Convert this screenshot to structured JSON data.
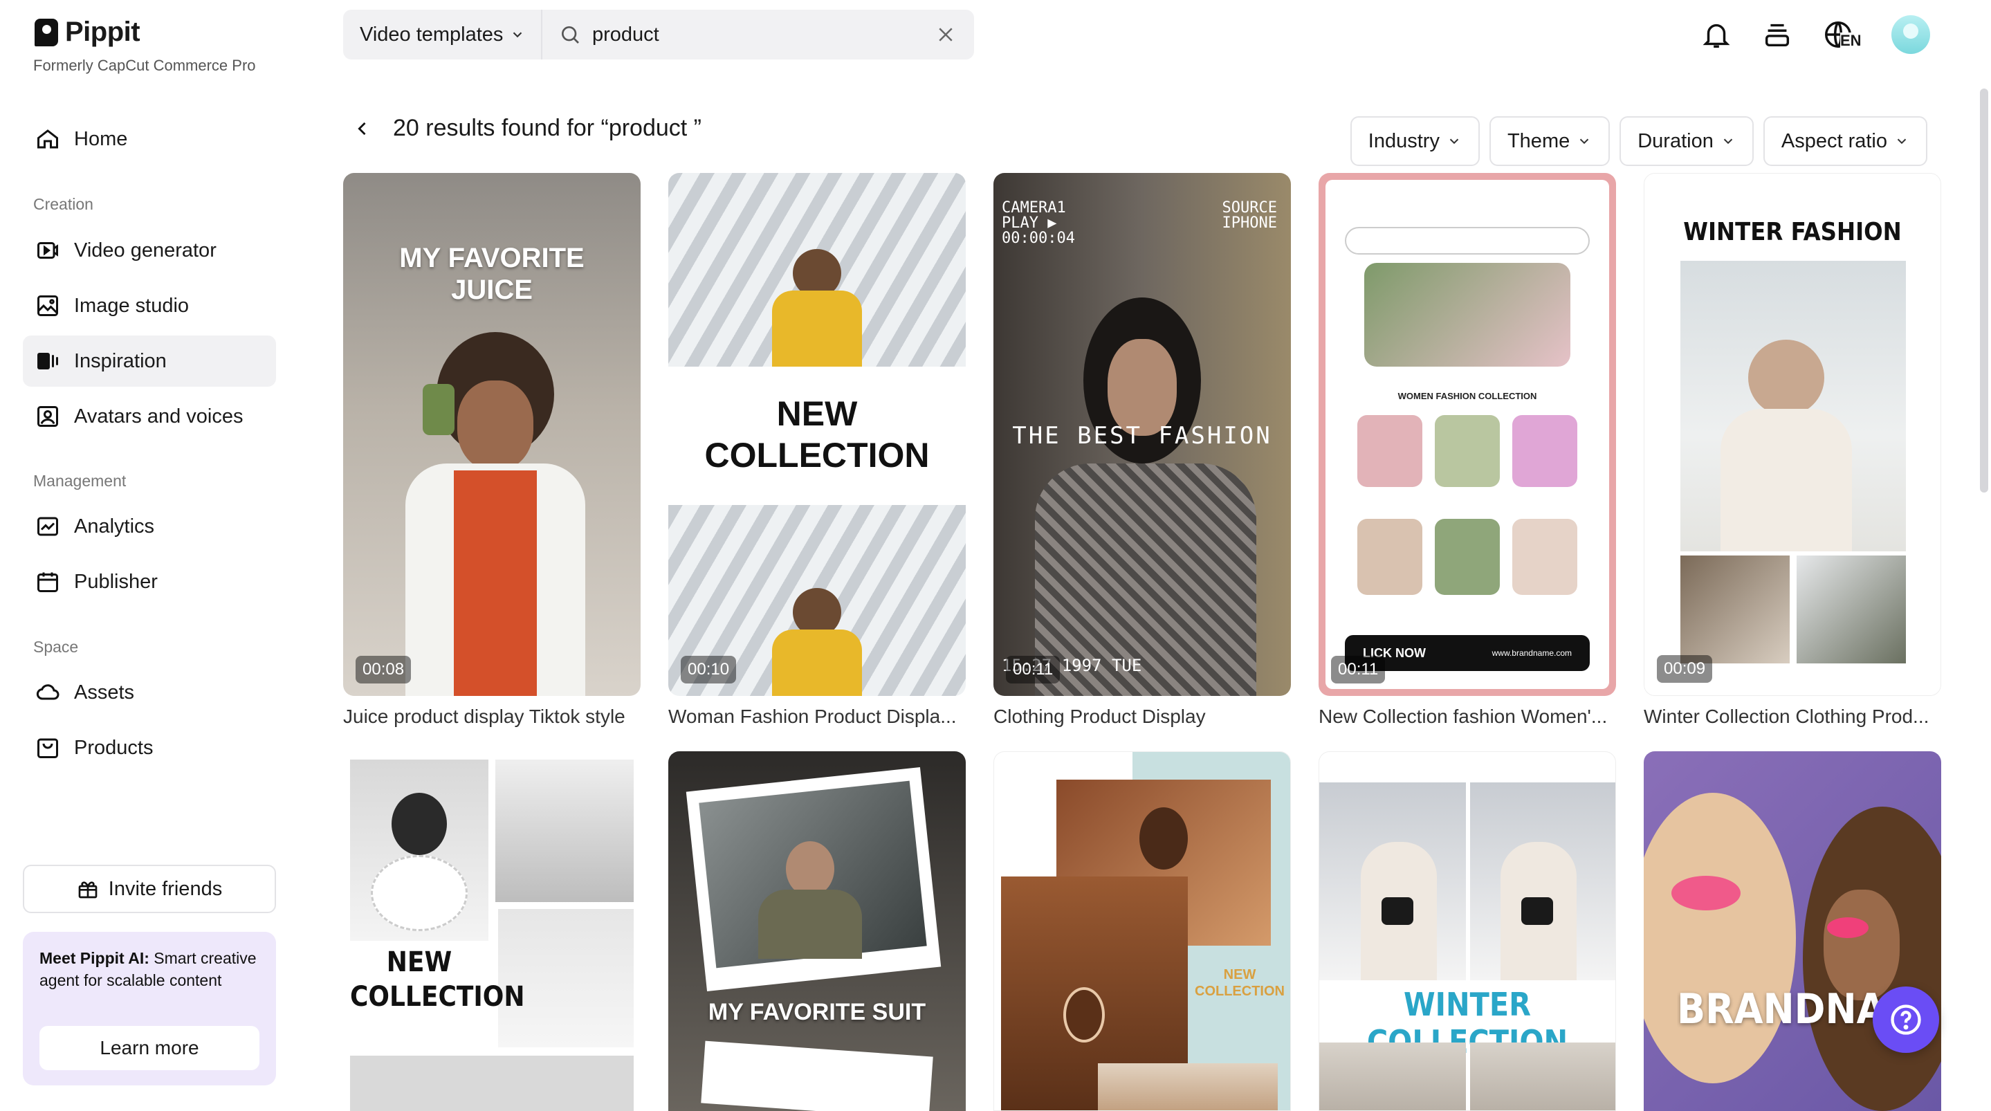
{
  "brand": {
    "name": "Pippit",
    "subtitle": "Formerly CapCut Commerce Pro"
  },
  "nav": {
    "home": "Home",
    "sections": {
      "creation": "Creation",
      "management": "Management",
      "space": "Space"
    },
    "video_generator": "Video generator",
    "image_studio": "Image studio",
    "inspiration": "Inspiration",
    "avatars_voices": "Avatars and voices",
    "analytics": "Analytics",
    "publisher": "Publisher",
    "assets": "Assets",
    "products": "Products"
  },
  "invite": {
    "label": "Invite friends"
  },
  "promo": {
    "title": "Meet Pippit AI:",
    "text": " Smart creative agent for scalable content",
    "button": "Learn more"
  },
  "search": {
    "template_type": "Video templates",
    "query": "product"
  },
  "header": {
    "language": "EN"
  },
  "results": {
    "text": "20 results found for “product ”"
  },
  "filters": {
    "industry": "Industry",
    "theme": "Theme",
    "duration": "Duration",
    "aspect": "Aspect ratio"
  },
  "cards": [
    {
      "title": "Juice product display Tiktok style",
      "duration": "00:08",
      "overlay": "MY FAVORITE JUICE"
    },
    {
      "title": "Woman Fashion Product Displa...",
      "duration": "00:10",
      "overlay": "NEW COLLECTION"
    },
    {
      "title": "Clothing Product Display",
      "duration": "00:11",
      "overlay": "THE BEST FASHION",
      "overlay_tl": "CAMERA1 PLAY ▶ 00:00:04",
      "overlay_tr": "SOURCE IPHONE",
      "overlay_bl": "15:27 1997 TUE"
    },
    {
      "title": "New Collection fashion Women'...",
      "duration": "00:11",
      "overlay": "WOMEN FASHION COLLECTION",
      "overlay_btn": "LICK NOW",
      "overlay_url": "www.brandname.com"
    },
    {
      "title": "Winter Collection Clothing Prod...",
      "duration": "00:09",
      "overlay": "WINTER FASHION"
    },
    {
      "overlay": "NEW COLLECTION"
    },
    {
      "overlay": "MY FAVORITE SUIT"
    },
    {
      "overlay": "NEW COLLECTION"
    },
    {
      "overlay": "WINTER COLLECTION"
    },
    {
      "overlay": "BRANDNAM"
    }
  ],
  "colors": {
    "accent": "#6a4df5",
    "active_bg": "#f1f1f3",
    "promo_bg": "#eee8fb"
  }
}
